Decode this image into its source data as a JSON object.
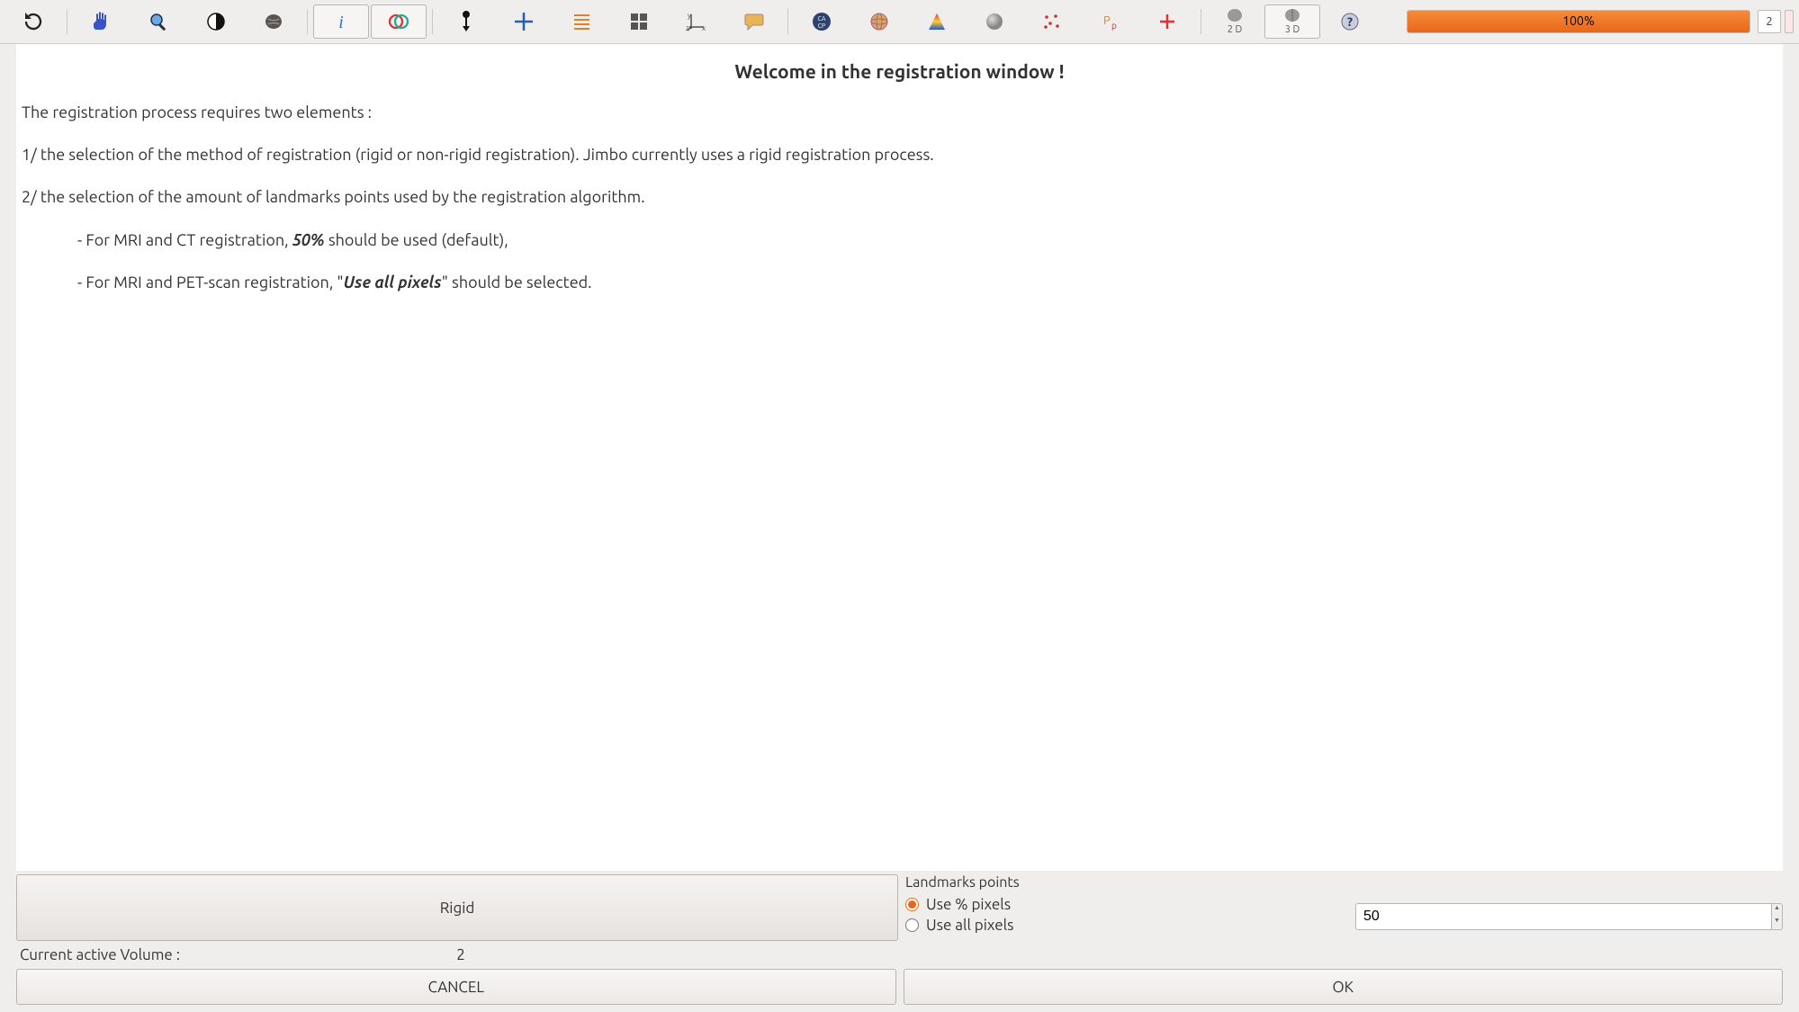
{
  "toolbar": {
    "progress_label": "100%",
    "page_value": "2",
    "icons": [
      "refresh-icon",
      "hand-icon",
      "zoom-icon",
      "contrast-icon",
      "brain-icon",
      "info-icon",
      "overlay-icon",
      "pin-icon",
      "crosshair-icon",
      "list-icon",
      "grid-icon",
      "axes-icon",
      "speech-icon",
      "cacp-icon",
      "globe-icon",
      "colormap-icon",
      "sphere-icon",
      "scatter-icon",
      "marker-icon",
      "plus-red-icon",
      "brain2d-icon",
      "brain3d-icon",
      "help-icon"
    ],
    "label_2d": "2 D",
    "label_3d": "3 D"
  },
  "content": {
    "title": "Welcome in the registration window !",
    "intro": "The registration process requires two elements :",
    "step1": "1/ the selection of the method of registration (rigid or non-rigid registration). Jimbo currently uses a rigid registration process.",
    "step2": "2/ the selection of the amount of landmarks points used by the registration algorithm.",
    "bullet1_pre": "- For MRI and CT registration, ",
    "bullet1_bold": "50% ",
    "bullet1_post": "should be used (default),",
    "bullet2_pre": "- For MRI and PET-scan registration, \"",
    "bullet2_bold": "Use all pixels",
    "bullet2_post": "\" should be selected."
  },
  "controls": {
    "rigid_label": "Rigid",
    "landmarks_title": "Landmarks points",
    "radio_percent": "Use % pixels",
    "radio_all": "Use all pixels",
    "percent_value": "50",
    "volume_label": "Current active Volume :",
    "volume_value": "2",
    "cancel_label": "CANCEL",
    "ok_label": "OK"
  }
}
